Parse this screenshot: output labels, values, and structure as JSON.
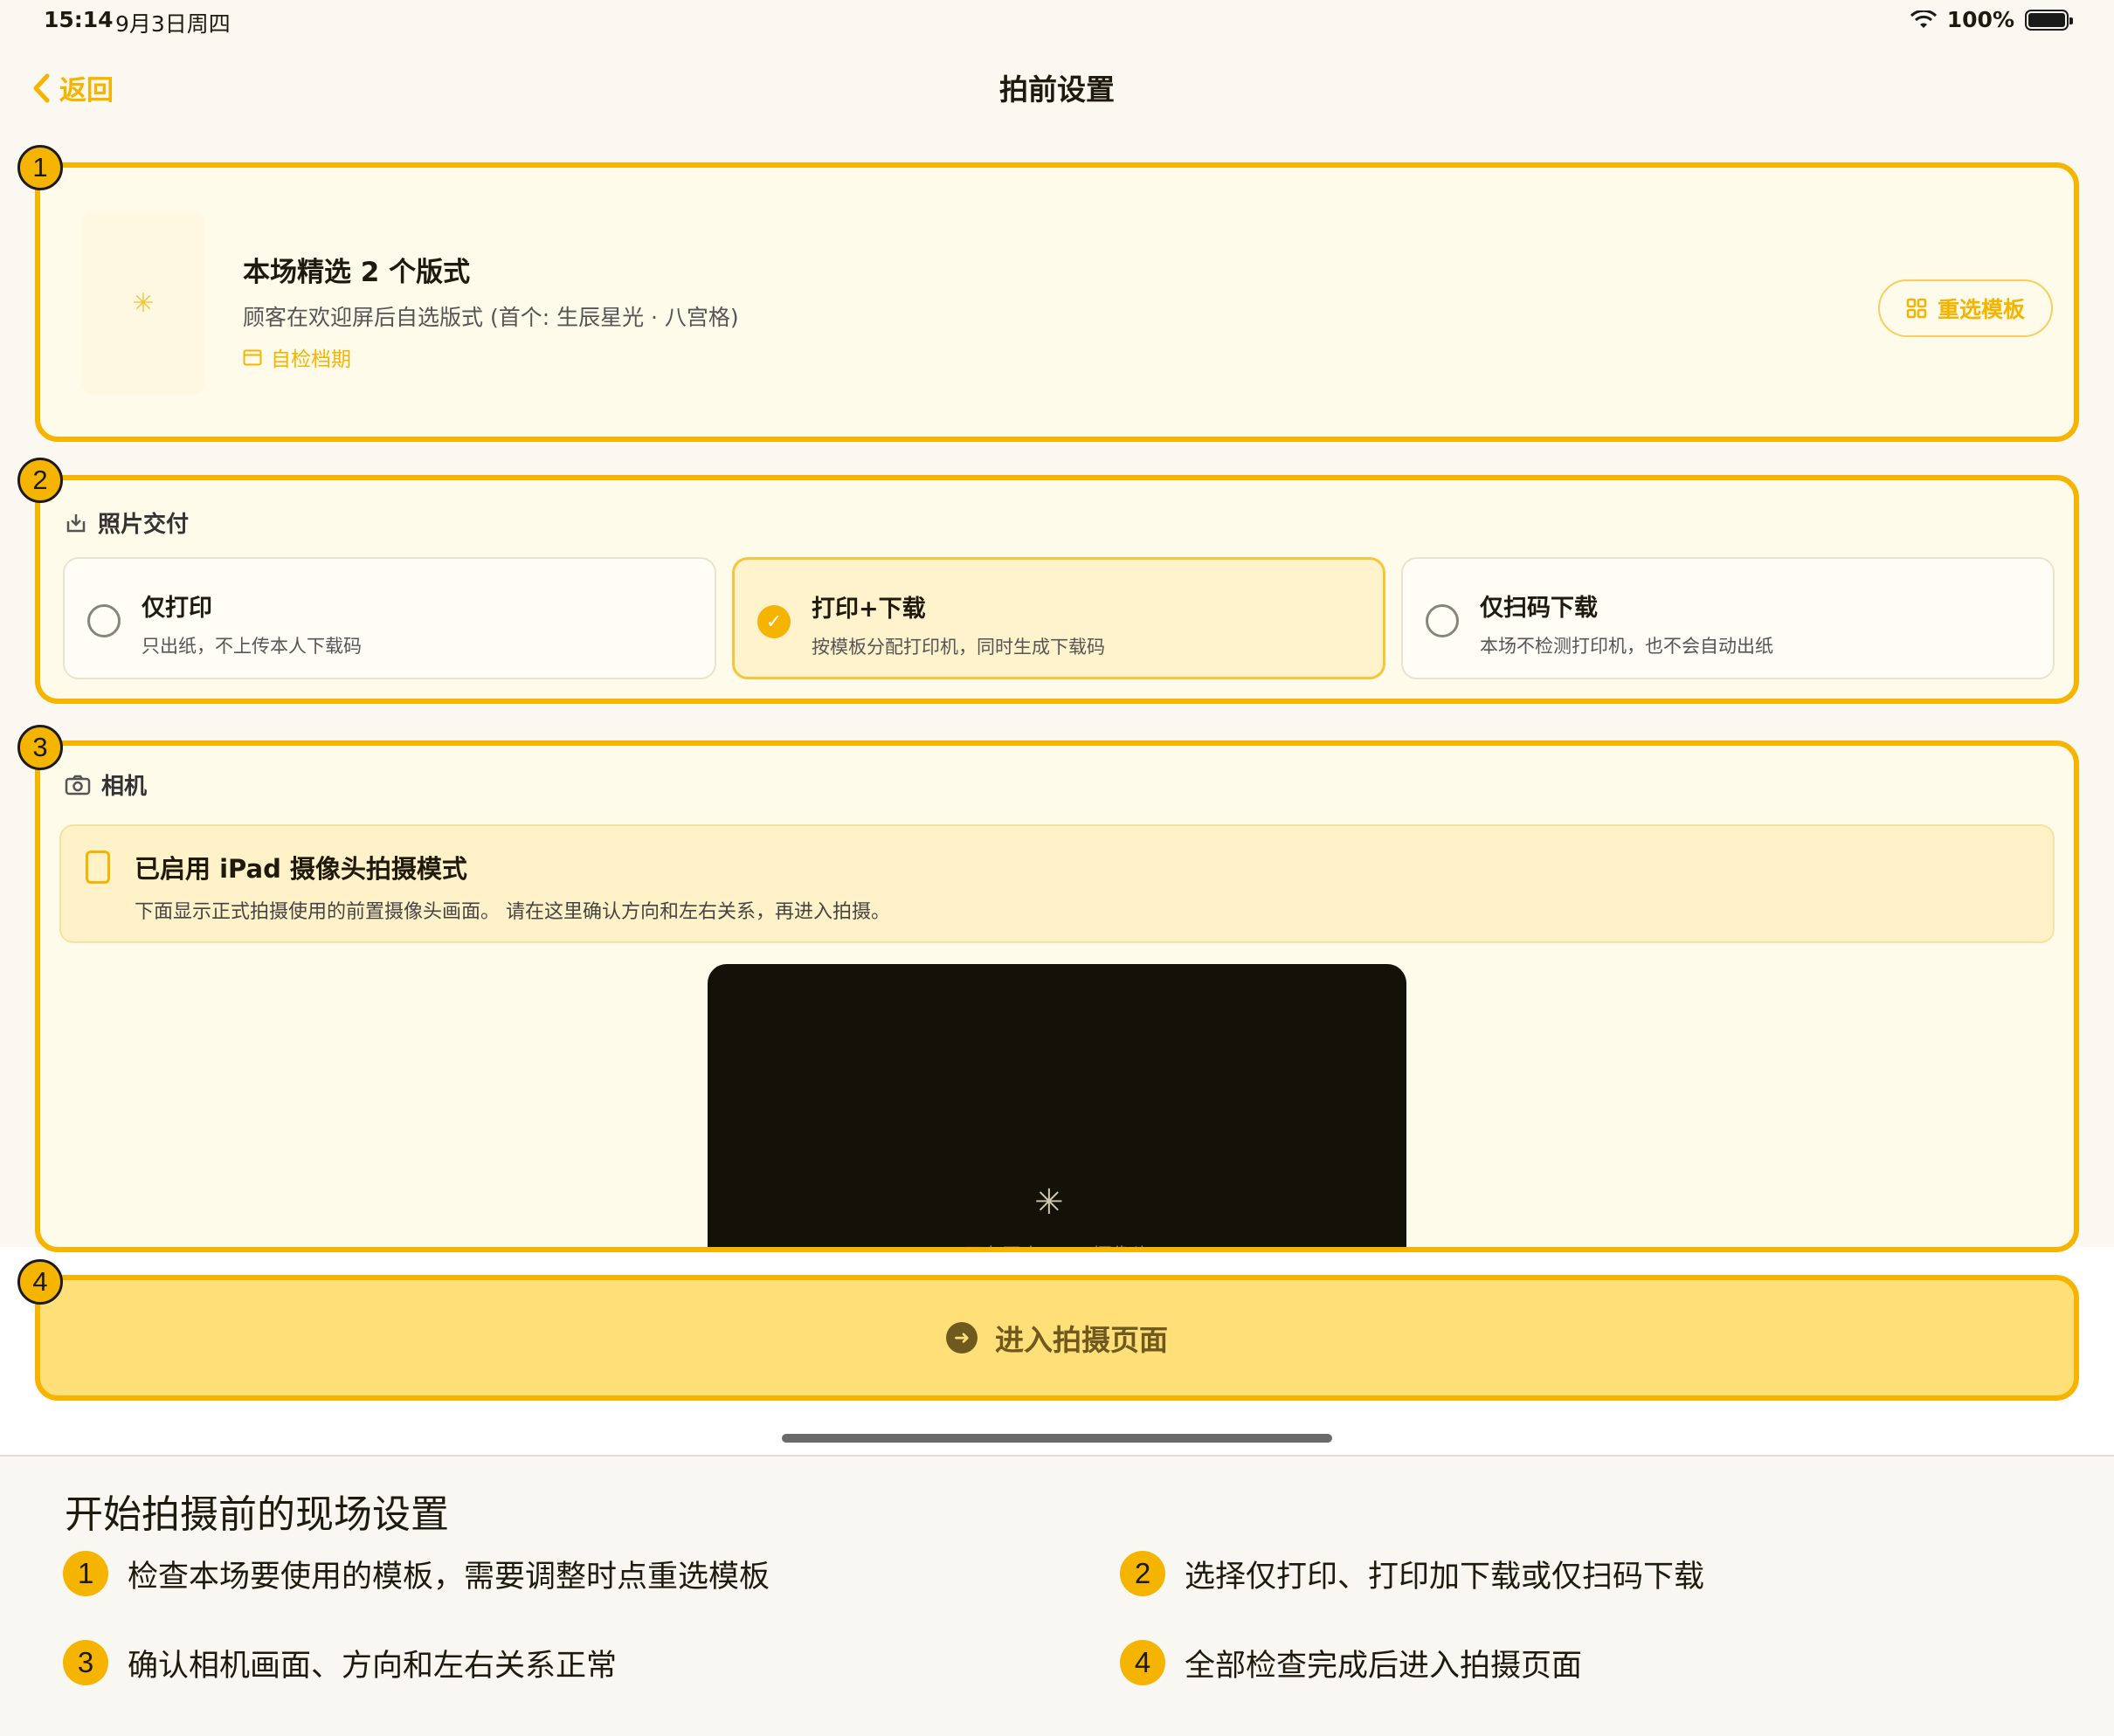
{
  "status": {
    "time": "15:14",
    "date": "9月3日周四",
    "battery": "100%"
  },
  "nav": {
    "back": "返回",
    "title": "拍前设置"
  },
  "badges": [
    "1",
    "2",
    "3",
    "4"
  ],
  "template": {
    "title": "本场精选 2 个版式",
    "subtitle": "顾客在欢迎屏后自选版式 (首个: 生辰星光 · 八宫格)",
    "link": "自检档期",
    "reselect": "重选模板"
  },
  "delivery": {
    "heading": "照片交付",
    "options": [
      {
        "title": "仅打印",
        "desc": "只出纸，不上传本人下载码",
        "selected": false
      },
      {
        "title": "打印+下载",
        "desc": "按模板分配打印机，同时生成下载码",
        "selected": true
      },
      {
        "title": "仅扫码下载",
        "desc": "本场不检测打印机，也不会自动出纸",
        "selected": false
      }
    ]
  },
  "camera": {
    "heading": "相机",
    "notice_title": "已启用 iPad 摄像头拍摄模式",
    "notice_desc": "下面显示正式拍摄使用的前置摄像头画面。 请在这里确认方向和左右关系，再进入拍摄。",
    "preview_text": "正在开启 iPad 摄像头"
  },
  "enter": {
    "label": "进入拍摄页面"
  },
  "guide": {
    "title": "开始拍摄前的现场设置",
    "items": [
      {
        "n": "1",
        "text": "检查本场要使用的模板，需要调整时点重选模板"
      },
      {
        "n": "2",
        "text": "选择仅打印、打印加下载或仅扫码下载"
      },
      {
        "n": "3",
        "text": "确认相机画面、方向和左右关系正常"
      },
      {
        "n": "4",
        "text": "全部检查完成后进入拍摄页面"
      }
    ]
  }
}
